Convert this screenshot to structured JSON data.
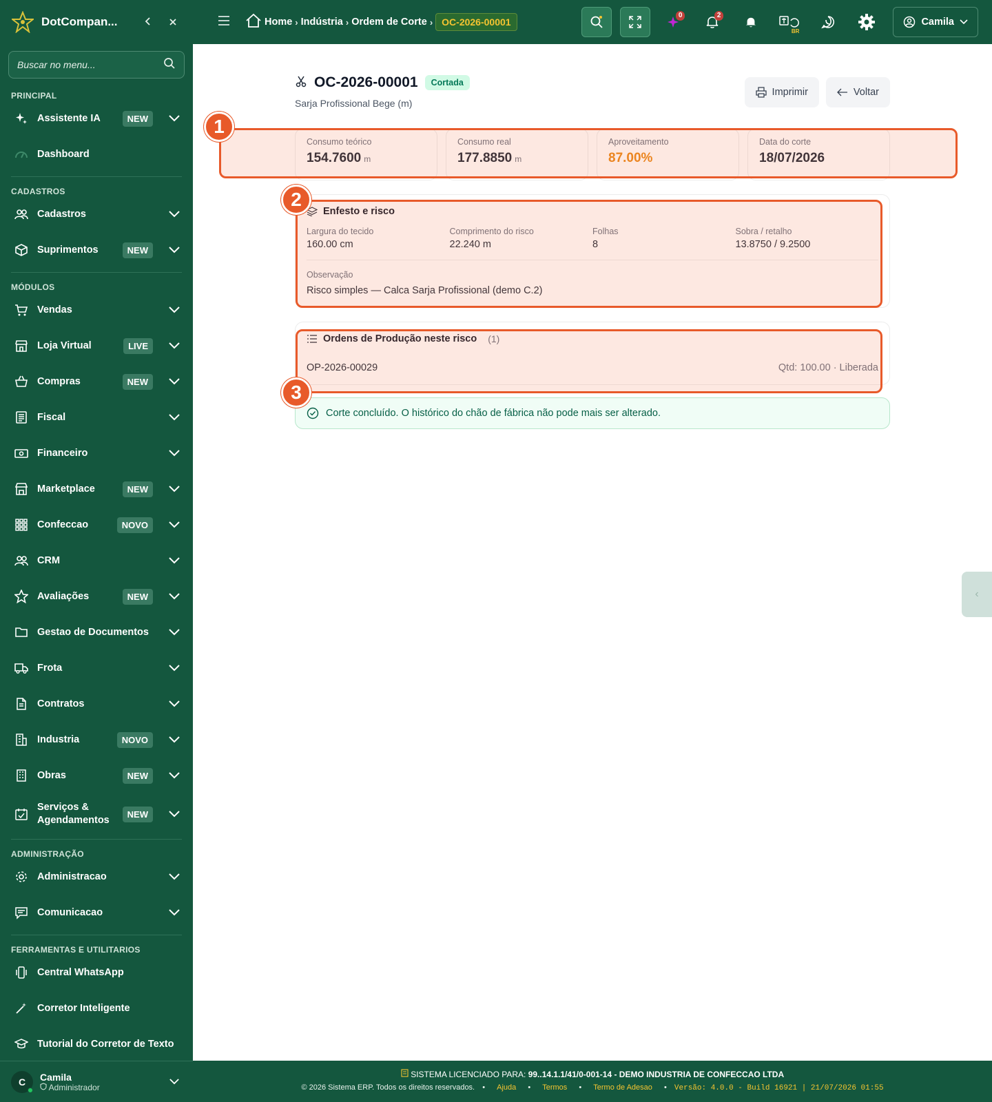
{
  "sidebar": {
    "brand": "DotCompan...",
    "search_placeholder": "Buscar no menu...",
    "sections": {
      "principal": "PRINCIPAL",
      "cadastros": "CADASTROS",
      "modulos": "MÓDULOS",
      "administracao": "ADMINISTRAÇÃO",
      "ferramentas": "FERRAMENTAS E UTILITARIOS"
    },
    "items": {
      "assistente": {
        "label": "Assistente IA",
        "badge": "NEW"
      },
      "dashboard": {
        "label": "Dashboard"
      },
      "cadastros": {
        "label": "Cadastros"
      },
      "suprimentos": {
        "label": "Suprimentos",
        "badge": "NEW"
      },
      "vendas": {
        "label": "Vendas"
      },
      "loja": {
        "label": "Loja Virtual",
        "badge": "LIVE"
      },
      "compras": {
        "label": "Compras",
        "badge": "NEW"
      },
      "fiscal": {
        "label": "Fiscal"
      },
      "financeiro": {
        "label": "Financeiro"
      },
      "marketplace": {
        "label": "Marketplace",
        "badge": "NEW"
      },
      "confeccao": {
        "label": "Confeccao",
        "badge": "NOVO"
      },
      "crm": {
        "label": "CRM"
      },
      "avaliacoes": {
        "label": "Avaliações",
        "badge": "NEW"
      },
      "documentos": {
        "label": "Gestao de Documentos"
      },
      "frota": {
        "label": "Frota"
      },
      "contratos": {
        "label": "Contratos"
      },
      "industria": {
        "label": "Industria",
        "badge": "NOVO"
      },
      "obras": {
        "label": "Obras",
        "badge": "NEW"
      },
      "servicos": {
        "label": "Serviços & Agendamentos",
        "badge": "NEW"
      },
      "administracao": {
        "label": "Administracao"
      },
      "comunicacao": {
        "label": "Comunicacao"
      },
      "whatsapp": {
        "label": "Central WhatsApp"
      },
      "corretor": {
        "label": "Corretor Inteligente"
      },
      "tutorial": {
        "label": "Tutorial do Corretor de Texto"
      }
    },
    "user": {
      "initial": "C",
      "name": "Camila",
      "role": "Administrador"
    }
  },
  "topbar": {
    "breadcrumb": {
      "home": "Home",
      "industria": "Indústria",
      "ordem": "Ordem de Corte",
      "current": "OC-2026-00001"
    },
    "badges": {
      "ai": "0",
      "notifications": "2"
    },
    "lang": "BR",
    "user": "Camila"
  },
  "page": {
    "title": "OC-2026-00001",
    "status": "Cortada",
    "subtitle": "Sarja Profissional Bege (m)",
    "print_label": "Imprimir",
    "back_label": "Voltar",
    "kpis": {
      "teorico": {
        "label": "Consumo teórico",
        "value": "154.7600",
        "unit": "m"
      },
      "real": {
        "label": "Consumo real",
        "value": "177.8850",
        "unit": "m"
      },
      "aproveitamento": {
        "label": "Aproveitamento",
        "value": "87.00%"
      },
      "data": {
        "label": "Data do corte",
        "value": "18/07/2026"
      }
    },
    "enfesto": {
      "title": "Enfesto e risco",
      "largura": {
        "label": "Largura do tecido",
        "value": "160.00 cm"
      },
      "comprimento": {
        "label": "Comprimento do risco",
        "value": "22.240 m"
      },
      "folhas": {
        "label": "Folhas",
        "value": "8"
      },
      "sobra": {
        "label": "Sobra / retalho",
        "value": "13.8750 / 9.2500"
      },
      "obs_label": "Observação",
      "obs_value": "Risco simples — Calca Sarja Profissional (demo C.2)"
    },
    "ordens": {
      "title": "Ordens de Produção neste risco",
      "count": "(1)",
      "row": {
        "code": "OP-2026-00029",
        "meta": "Qtd: 100.00 · Liberada"
      }
    },
    "success_msg": "Corte concluído. O histórico do chão de fábrica não pode mais ser alterado."
  },
  "annotations": {
    "one": "1",
    "two": "2",
    "three": "3"
  },
  "footer": {
    "licensed_prefix": "SISTEMA LICENCIADO PARA:",
    "licensed_to": "99..14.1.1/41/0-001-14 - DEMO INDUSTRIA DE CONFECCAO LTDA",
    "copyright": "© 2026 Sistema ERP. Todos os direitos reservados.",
    "links": {
      "ajuda": "Ajuda",
      "termos": "Termos",
      "adesao": "Termo de Adesao"
    },
    "version": "Versão: 4.0.0 - Build 16921 | 21/07/2026 01:55"
  }
}
